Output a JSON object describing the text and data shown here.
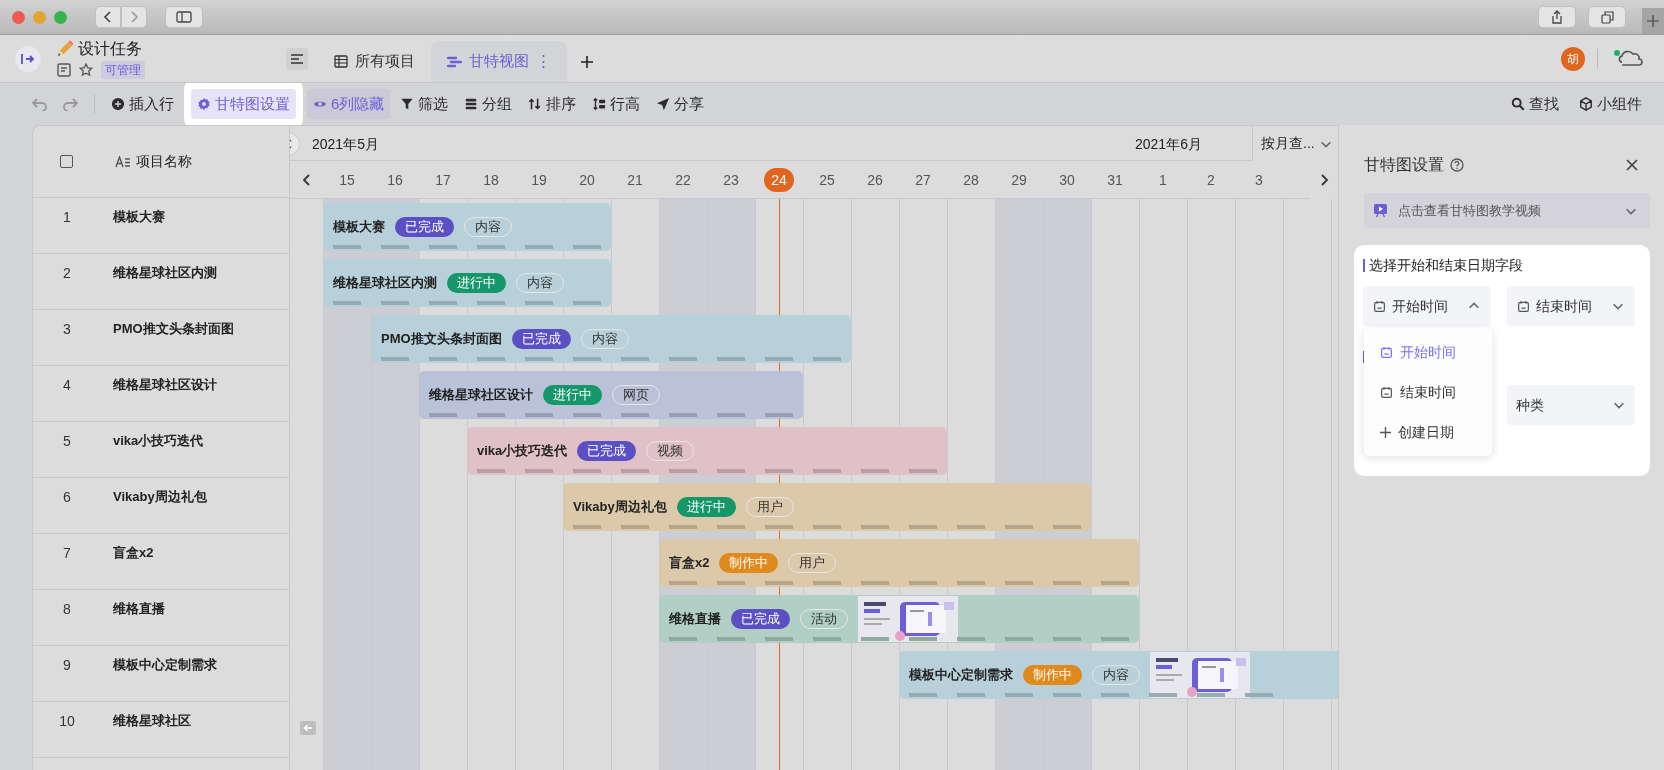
{
  "header": {
    "title": "设计任务",
    "badge": "可管理",
    "tabs": [
      {
        "label": "所有项目",
        "kind": "table",
        "selected": false
      },
      {
        "label": "甘特视图",
        "kind": "gantt",
        "selected": true,
        "more": "⋮"
      }
    ],
    "avatar": "胡"
  },
  "toolbar": {
    "left": [
      {
        "label": "插入行",
        "kind": "insert",
        "active": false,
        "highlighted": false
      },
      {
        "label": "甘特图设置",
        "kind": "settings",
        "active": true,
        "highlighted": true
      },
      {
        "label": "6列隐藏",
        "kind": "hide",
        "active": true,
        "highlighted": false
      },
      {
        "label": "筛选",
        "kind": "filter",
        "active": false,
        "highlighted": false
      },
      {
        "label": "分组",
        "kind": "group",
        "active": false,
        "highlighted": false
      },
      {
        "label": "排序",
        "kind": "sort",
        "active": false,
        "highlighted": false
      },
      {
        "label": "行高",
        "kind": "height",
        "active": false,
        "highlighted": false
      },
      {
        "label": "分享",
        "kind": "share",
        "active": false,
        "highlighted": false
      }
    ],
    "right": [
      {
        "label": "查找",
        "kind": "search",
        "active": false,
        "highlighted": false
      },
      {
        "label": "小组件",
        "kind": "widget",
        "active": false,
        "highlighted": false
      }
    ]
  },
  "table": {
    "all_checked": false,
    "column": "项目名称",
    "rows": [
      {
        "number": "1",
        "name": "模板大赛"
      },
      {
        "number": "2",
        "name": "维格星球社区内测"
      },
      {
        "number": "3",
        "name": "PMO推文头条封面图"
      },
      {
        "number": "4",
        "name": "维格星球社区设计"
      },
      {
        "number": "5",
        "name": "vika小技巧迭代"
      },
      {
        "number": "6",
        "name": "Vikaby周边礼包"
      },
      {
        "number": "7",
        "name": "盲盒x2"
      },
      {
        "number": "8",
        "name": "维格直播"
      },
      {
        "number": "9",
        "name": "模板中心定制需求"
      },
      {
        "number": "10",
        "name": "维格星球社区"
      }
    ]
  },
  "gantt": {
    "months": [
      {
        "label": "2021年5月",
        "days": [
          {
            "label": "15",
            "weekend": true,
            "today": false
          },
          {
            "label": "16",
            "weekend": true,
            "today": false
          },
          {
            "label": "17",
            "weekend": false,
            "today": false
          },
          {
            "label": "18",
            "weekend": false,
            "today": false
          },
          {
            "label": "19",
            "weekend": false,
            "today": false
          },
          {
            "label": "20",
            "weekend": false,
            "today": false
          },
          {
            "label": "21",
            "weekend": false,
            "today": false
          },
          {
            "label": "22",
            "weekend": true,
            "today": false
          },
          {
            "label": "23",
            "weekend": true,
            "today": false
          },
          {
            "label": "24",
            "weekend": false,
            "today": true
          },
          {
            "label": "25",
            "weekend": false,
            "today": false
          },
          {
            "label": "26",
            "weekend": false,
            "today": false
          },
          {
            "label": "27",
            "weekend": false,
            "today": false
          },
          {
            "label": "28",
            "weekend": false,
            "today": false
          },
          {
            "label": "29",
            "weekend": true,
            "today": false
          },
          {
            "label": "30",
            "weekend": true,
            "today": false
          },
          {
            "label": "31",
            "weekend": false,
            "today": false
          }
        ]
      },
      {
        "label": "2021年6月",
        "days": [
          {
            "label": "1",
            "weekend": false,
            "today": false
          },
          {
            "label": "2",
            "weekend": false,
            "today": false
          },
          {
            "label": "3",
            "weekend": false,
            "today": false
          }
        ]
      }
    ],
    "view_select": "按月查...",
    "bars": [
      {
        "name": "模板大赛",
        "color": "#b8d0d9",
        "status": {
          "label": "已完成",
          "color": "#5b4fc4"
        },
        "tag": "内容",
        "thumbnail": false,
        "days": [
          {
            "on": true
          },
          {
            "on": true
          },
          {
            "on": true
          },
          {
            "on": true
          },
          {
            "on": true
          },
          {
            "on": true
          },
          {
            "on": false
          },
          {
            "on": false
          },
          {
            "on": false
          },
          {
            "on": false
          },
          {
            "on": false
          },
          {
            "on": false
          },
          {
            "on": false
          },
          {
            "on": false
          },
          {
            "on": false
          },
          {
            "on": false
          },
          {
            "on": false
          },
          {
            "on": false
          },
          {
            "on": false
          },
          {
            "on": false
          }
        ]
      },
      {
        "name": "维格星球社区内测",
        "color": "#b8d0d9",
        "status": {
          "label": "进行中",
          "color": "#16976a"
        },
        "tag": "内容",
        "thumbnail": false,
        "days": [
          {
            "on": true
          },
          {
            "on": true
          },
          {
            "on": true
          },
          {
            "on": true
          },
          {
            "on": true
          },
          {
            "on": true
          },
          {
            "on": false
          },
          {
            "on": false
          },
          {
            "on": false
          },
          {
            "on": false
          },
          {
            "on": false
          },
          {
            "on": false
          },
          {
            "on": false
          },
          {
            "on": false
          },
          {
            "on": false
          },
          {
            "on": false
          },
          {
            "on": false
          },
          {
            "on": false
          },
          {
            "on": false
          },
          {
            "on": false
          }
        ]
      },
      {
        "name": "PMO推文头条封面图",
        "color": "#b8d0d9",
        "status": {
          "label": "已完成",
          "color": "#5b4fc4"
        },
        "tag": "内容",
        "thumbnail": false,
        "days": [
          {
            "on": false
          },
          {
            "on": true
          },
          {
            "on": true
          },
          {
            "on": true
          },
          {
            "on": true
          },
          {
            "on": true
          },
          {
            "on": true
          },
          {
            "on": true
          },
          {
            "on": true
          },
          {
            "on": true
          },
          {
            "on": true
          },
          {
            "on": false
          },
          {
            "on": false
          },
          {
            "on": false
          },
          {
            "on": false
          },
          {
            "on": false
          },
          {
            "on": false
          },
          {
            "on": false
          },
          {
            "on": false
          },
          {
            "on": false
          }
        ]
      },
      {
        "name": "维格星球社区设计",
        "color": "#b9c2d9",
        "status": {
          "label": "进行中",
          "color": "#16976a"
        },
        "tag": "网页",
        "thumbnail": false,
        "days": [
          {
            "on": false
          },
          {
            "on": false
          },
          {
            "on": true
          },
          {
            "on": true
          },
          {
            "on": true
          },
          {
            "on": true
          },
          {
            "on": true
          },
          {
            "on": true
          },
          {
            "on": true
          },
          {
            "on": true
          },
          {
            "on": false
          },
          {
            "on": false
          },
          {
            "on": false
          },
          {
            "on": false
          },
          {
            "on": false
          },
          {
            "on": false
          },
          {
            "on": false
          },
          {
            "on": false
          },
          {
            "on": false
          },
          {
            "on": false
          }
        ]
      },
      {
        "name": "vika小技巧迭代",
        "color": "#dfc1c7",
        "status": {
          "label": "已完成",
          "color": "#5b4fc4"
        },
        "tag": "视频",
        "thumbnail": false,
        "days": [
          {
            "on": false
          },
          {
            "on": false
          },
          {
            "on": false
          },
          {
            "on": true
          },
          {
            "on": true
          },
          {
            "on": true
          },
          {
            "on": true
          },
          {
            "on": true
          },
          {
            "on": true
          },
          {
            "on": true
          },
          {
            "on": true
          },
          {
            "on": true
          },
          {
            "on": true
          },
          {
            "on": false
          },
          {
            "on": false
          },
          {
            "on": false
          },
          {
            "on": false
          },
          {
            "on": false
          },
          {
            "on": false
          },
          {
            "on": false
          }
        ]
      },
      {
        "name": "Vikaby周边礼包",
        "color": "#dbc9aa",
        "status": {
          "label": "进行中",
          "color": "#16976a"
        },
        "tag": "用户",
        "thumbnail": false,
        "days": [
          {
            "on": false
          },
          {
            "on": false
          },
          {
            "on": false
          },
          {
            "on": false
          },
          {
            "on": false
          },
          {
            "on": true
          },
          {
            "on": true
          },
          {
            "on": true
          },
          {
            "on": true
          },
          {
            "on": true
          },
          {
            "on": true
          },
          {
            "on": true
          },
          {
            "on": true
          },
          {
            "on": true
          },
          {
            "on": true
          },
          {
            "on": true
          },
          {
            "on": false
          },
          {
            "on": false
          },
          {
            "on": false
          },
          {
            "on": false
          }
        ]
      },
      {
        "name": "盲盒x2",
        "color": "#dbc9aa",
        "status": {
          "label": "制作中",
          "color": "#e08a1e"
        },
        "tag": "用户",
        "thumbnail": false,
        "days": [
          {
            "on": false
          },
          {
            "on": false
          },
          {
            "on": false
          },
          {
            "on": false
          },
          {
            "on": false
          },
          {
            "on": false
          },
          {
            "on": false
          },
          {
            "on": true
          },
          {
            "on": true
          },
          {
            "on": true
          },
          {
            "on": true
          },
          {
            "on": true
          },
          {
            "on": true
          },
          {
            "on": true
          },
          {
            "on": true
          },
          {
            "on": true
          },
          {
            "on": true
          },
          {
            "on": false
          },
          {
            "on": false
          },
          {
            "on": false
          }
        ]
      },
      {
        "name": "维格直播",
        "color": "#b1cfc4",
        "status": {
          "label": "已完成",
          "color": "#5b4fc4"
        },
        "tag": "活动",
        "thumbnail": true,
        "days": [
          {
            "on": false
          },
          {
            "on": false
          },
          {
            "on": false
          },
          {
            "on": false
          },
          {
            "on": false
          },
          {
            "on": false
          },
          {
            "on": false
          },
          {
            "on": true
          },
          {
            "on": true
          },
          {
            "on": true
          },
          {
            "on": true
          },
          {
            "on": true
          },
          {
            "on": true
          },
          {
            "on": true
          },
          {
            "on": true
          },
          {
            "on": true
          },
          {
            "on": true
          },
          {
            "on": false
          },
          {
            "on": false
          },
          {
            "on": false
          }
        ]
      },
      {
        "name": "模板中心定制需求",
        "color": "#b8d0d9",
        "status": {
          "label": "制作中",
          "color": "#e08a1e"
        },
        "tag": "内容",
        "thumbnail": true,
        "days": [
          {
            "on": false
          },
          {
            "on": false
          },
          {
            "on": false
          },
          {
            "on": false
          },
          {
            "on": false
          },
          {
            "on": false
          },
          {
            "on": false
          },
          {
            "on": false
          },
          {
            "on": false
          },
          {
            "on": false
          },
          {
            "on": false
          },
          {
            "on": false
          },
          {
            "on": true
          },
          {
            "on": true
          },
          {
            "on": true
          },
          {
            "on": true
          },
          {
            "on": true
          },
          {
            "on": true
          },
          {
            "on": true
          },
          {
            "on": true
          }
        ]
      }
    ]
  },
  "panel": {
    "title": "甘特图设置",
    "video_link": "点击查看甘特图教学视频",
    "section": "选择开始和结束日期字段",
    "start_field": {
      "label": "开始时间",
      "expanded": true
    },
    "end_field": {
      "label": "结束时间",
      "expanded": false
    },
    "menu": [
      {
        "label": "开始时间",
        "kind": "date",
        "selected": true
      },
      {
        "label": "结束时间",
        "kind": "date",
        "selected": false
      },
      {
        "label": "创建日期",
        "kind": "create",
        "selected": false
      }
    ],
    "color_field": {
      "label": "种类",
      "expanded": false
    }
  }
}
